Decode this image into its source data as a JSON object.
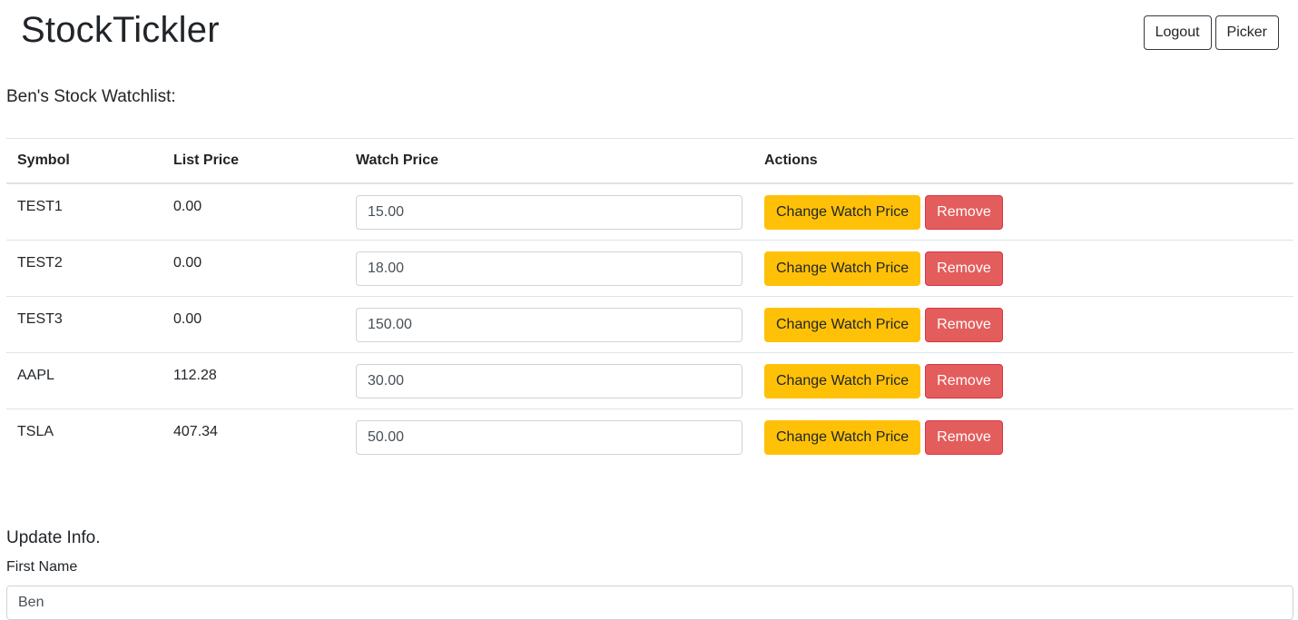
{
  "app": {
    "title": "StockTickler"
  },
  "header": {
    "logout_label": "Logout",
    "picker_label": "Picker"
  },
  "watchlist": {
    "title": "Ben's Stock Watchlist:",
    "columns": [
      "Symbol",
      "List Price",
      "Watch Price",
      "Actions"
    ],
    "rows": [
      {
        "symbol": "TEST1",
        "list_price": "0.00",
        "watch_price": "15.00"
      },
      {
        "symbol": "TEST2",
        "list_price": "0.00",
        "watch_price": "18.00"
      },
      {
        "symbol": "TEST3",
        "list_price": "0.00",
        "watch_price": "150.00"
      },
      {
        "symbol": "AAPL",
        "list_price": "112.28",
        "watch_price": "30.00"
      },
      {
        "symbol": "TSLA",
        "list_price": "407.34",
        "watch_price": "50.00"
      }
    ],
    "change_label": "Change Watch Price",
    "remove_label": "Remove"
  },
  "update_info": {
    "title": "Update Info.",
    "first_name_label": "First Name",
    "first_name_value": "Ben"
  },
  "colors": {
    "warning": "#ffc107",
    "danger": "#e35d5d"
  }
}
